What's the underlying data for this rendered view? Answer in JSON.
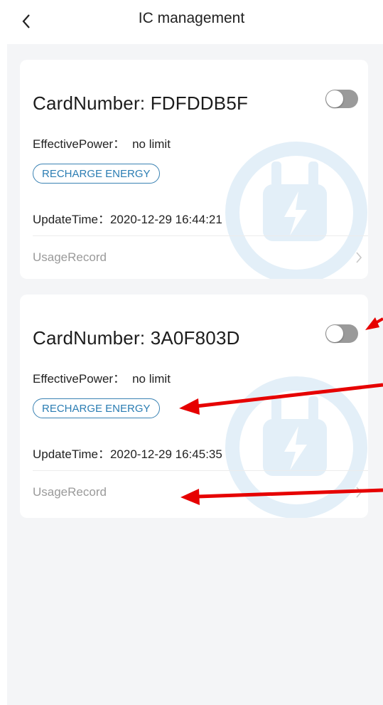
{
  "header": {
    "title": "IC management",
    "back_icon": "chevron-left-icon"
  },
  "cards": [
    {
      "card_number_label": "CardNumber: ",
      "card_number": "FDFDDB5F",
      "toggle_on": false,
      "effective_power_label": "EffectivePower：",
      "effective_power_value": "no limit",
      "recharge_label": "RECHARGE ENERGY",
      "update_time_label": "UpdateTime：",
      "update_time_value": "2020-12-29 16:44:21",
      "usage_record_label": "UsageRecord"
    },
    {
      "card_number_label": "CardNumber: ",
      "card_number": "3A0F803D",
      "toggle_on": false,
      "effective_power_label": "EffectivePower：",
      "effective_power_value": "no limit",
      "recharge_label": "RECHARGE ENERGY",
      "update_time_label": "UpdateTime：",
      "update_time_value": "2020-12-29 16:45:35",
      "usage_record_label": "UsageRecord"
    }
  ],
  "colors": {
    "accent": "#2b7db3",
    "annotation_arrow": "#e60000",
    "toggle_off": "#9a9a9a",
    "watermark": "#e3eff8"
  }
}
